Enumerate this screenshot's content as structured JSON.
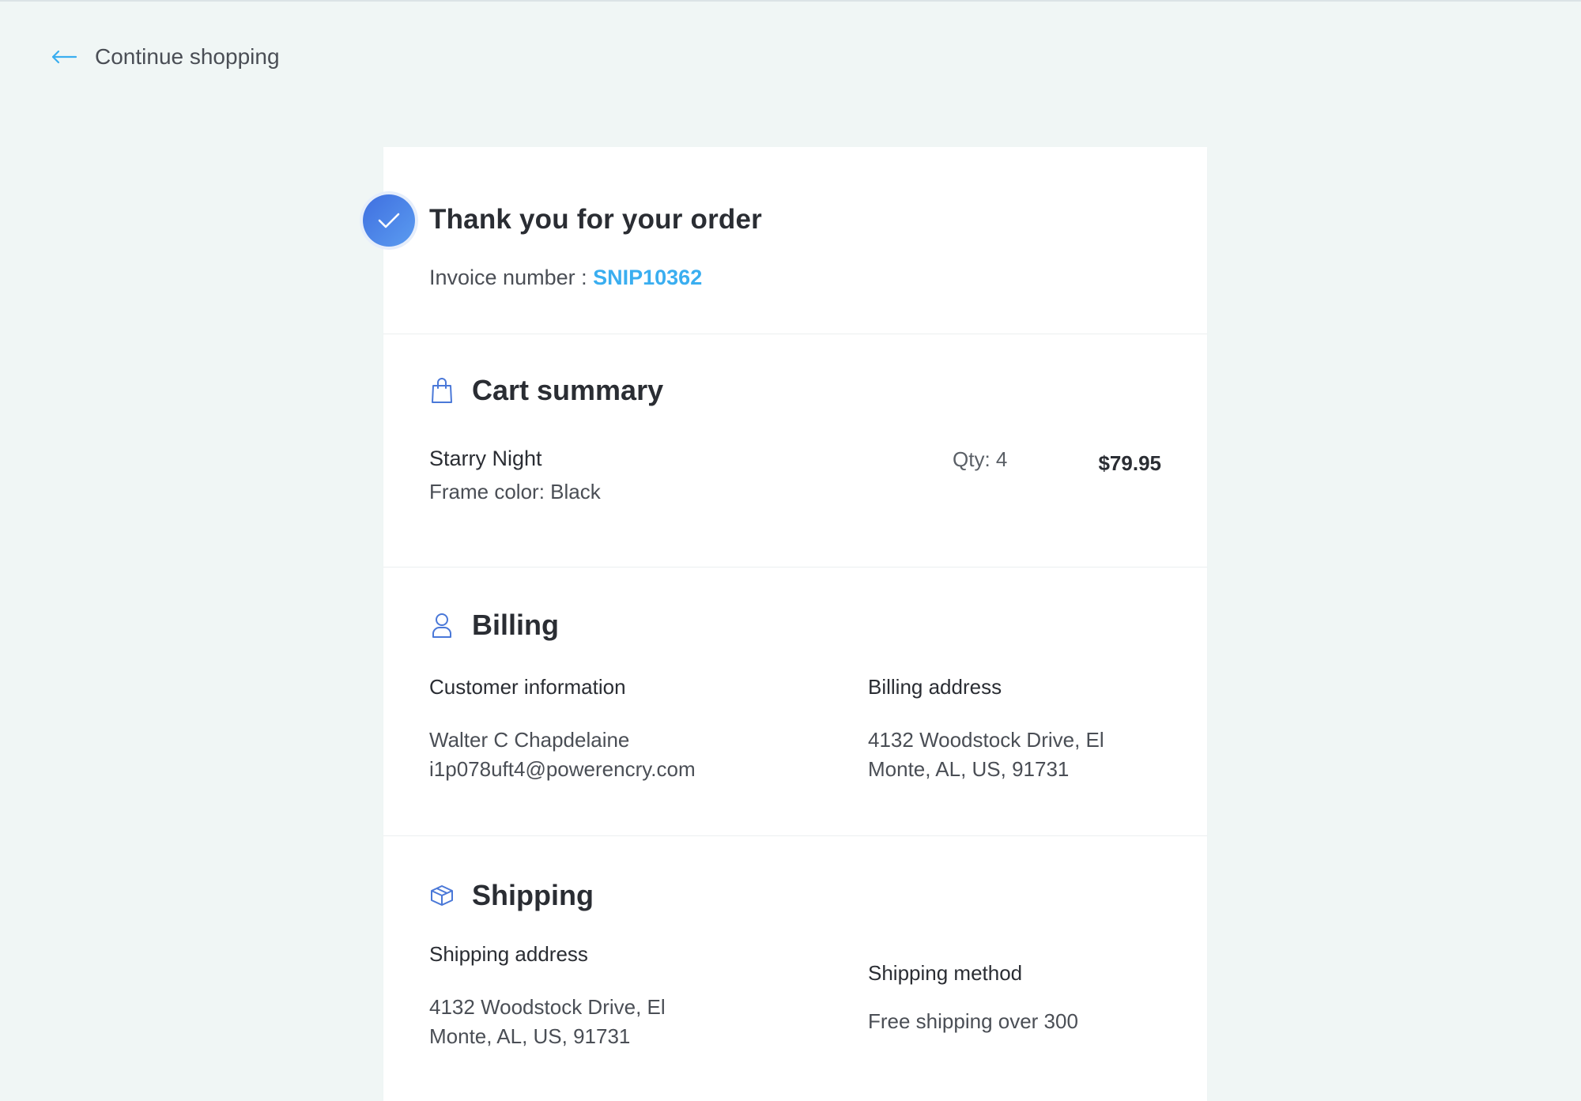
{
  "nav": {
    "back_label": "Continue shopping"
  },
  "confirmation": {
    "title": "Thank you for your order",
    "invoice_label": "Invoice number : ",
    "invoice_number": "SNIP10362"
  },
  "cart": {
    "title": "Cart summary",
    "item": {
      "name": "Starry Night",
      "variant": "Frame color: Black",
      "qty": "Qty: 4",
      "price": "$79.95"
    }
  },
  "billing": {
    "title": "Billing",
    "customer_label": "Customer information",
    "customer_name": "Walter C Chapdelaine",
    "customer_email": "i1p078uft4@powerencry.com",
    "address_label": "Billing address",
    "address_line1": "4132 Woodstock Drive, El",
    "address_line2": "Monte, AL, US, 91731"
  },
  "shipping": {
    "title": "Shipping",
    "address_label": "Shipping address",
    "address_line1": "4132 Woodstock Drive, El",
    "address_line2": "Monte, AL, US, 91731",
    "method_label": "Shipping method",
    "method_value": "Free shipping over 300"
  },
  "colors": {
    "accent": "#3aaef0",
    "badge": "#4a82e8",
    "icon": "#4a78d8",
    "background": "#f0f6f5"
  },
  "icons": {
    "back": "arrow-left-icon",
    "check": "check-icon",
    "cart": "shopping-bag-icon",
    "billing": "user-icon",
    "shipping": "package-icon"
  }
}
